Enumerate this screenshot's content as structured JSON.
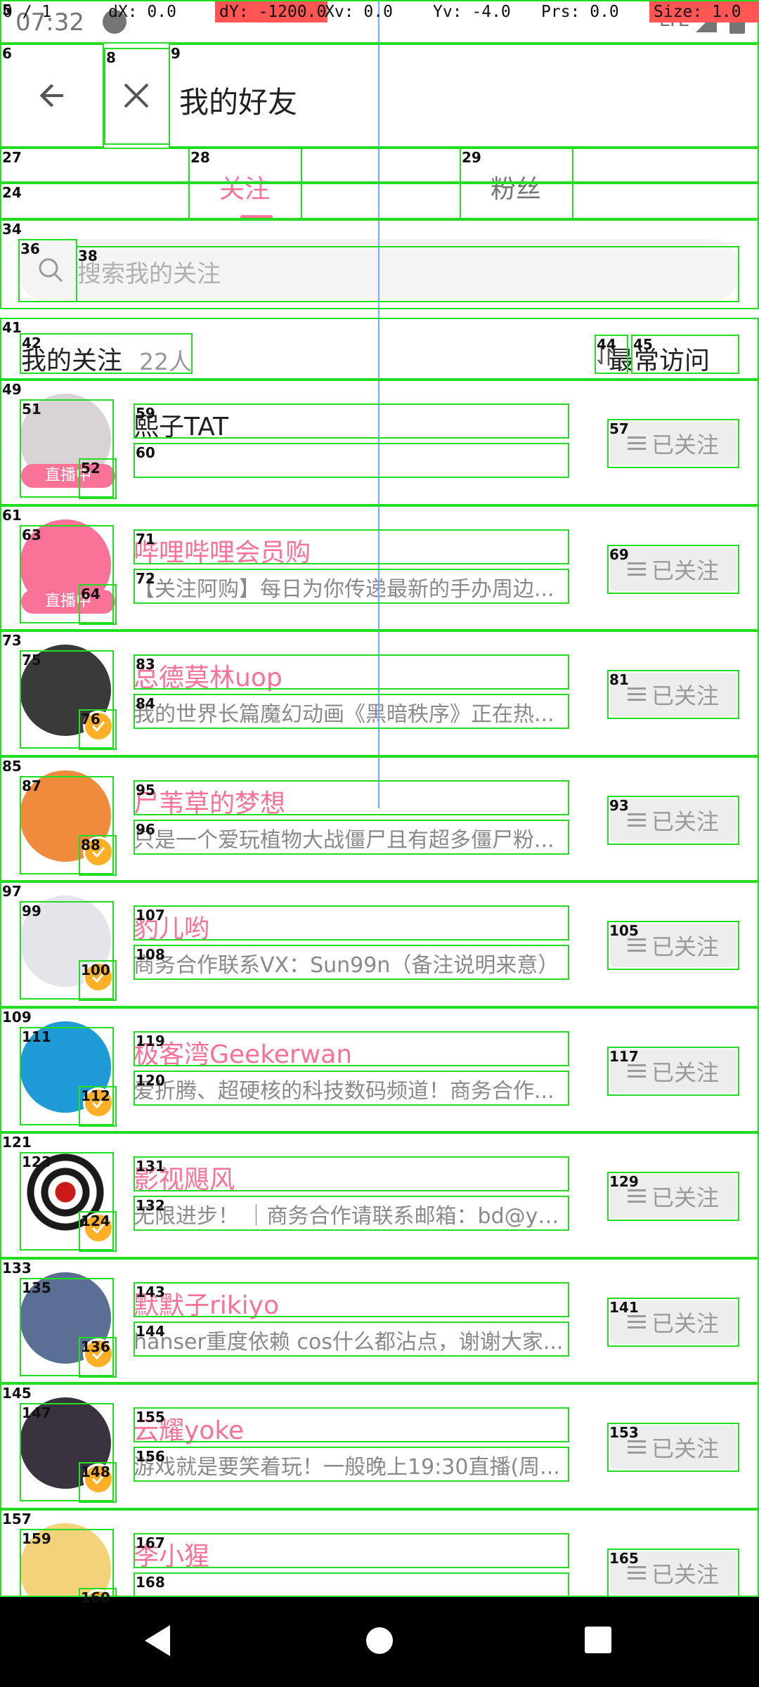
{
  "debug": {
    "pointers": "0 / 1",
    "dx": "dX: 0.0",
    "dy": "dY: -1200.0",
    "xv": "Xv: 0.0",
    "yv": "Yv: -4.0",
    "prs": "Prs: 0.0",
    "size": "Size: 1.0"
  },
  "status_bar": {
    "time": "07:32",
    "network": "LTE"
  },
  "toolbar": {
    "title": "我的好友"
  },
  "tabs": [
    {
      "label": "关注",
      "active": true
    },
    {
      "label": "粉丝",
      "active": false
    }
  ],
  "search": {
    "placeholder": "搜索我的关注"
  },
  "section": {
    "title": "我的关注",
    "count": "22人",
    "sort_label": "最常访问"
  },
  "follow_button_label": "已关注",
  "live_badge_label": "直播中",
  "users": [
    {
      "name": "熙子TAT",
      "desc": "",
      "live": true,
      "verified": false,
      "avatar_color": "#d9d3d6",
      "name_color": "#212121"
    },
    {
      "name": "哔哩哔哩会员购",
      "desc": "【关注阿购】每日为你传递最新的手办周边...",
      "live": true,
      "verified": false,
      "avatar_color": "#fb7299",
      "name_color": "#fb7299"
    },
    {
      "name": "总德莫林uop",
      "desc": "我的世界长篇魔幻动画《黑暗秩序》正在热...",
      "live": false,
      "verified": true,
      "avatar_color": "#3a3a3a",
      "name_color": "#fb7299"
    },
    {
      "name": "尸苇草的梦想",
      "desc": "只是一个爱玩植物大战僵尸且有超多僵尸粉...",
      "live": false,
      "verified": true,
      "avatar_color": "#f08a3c",
      "name_color": "#fb7299"
    },
    {
      "name": "豹儿哟",
      "desc": "商务合作联系VX：Sun99n（备注说明来意）",
      "live": false,
      "verified": true,
      "avatar_color": "#e4e4ea",
      "name_color": "#fb7299"
    },
    {
      "name": "极客湾Geekerwan",
      "desc": "爱折腾、超硬核的科技数码频道！商务合作...",
      "live": false,
      "verified": true,
      "avatar_color": "#1e9ad6",
      "name_color": "#fb7299"
    },
    {
      "name": "影视飓风",
      "desc": "无限进步！ ｜商务合作请联系邮箱：bd@ys...",
      "live": false,
      "verified": true,
      "avatar_color": "#ffffff",
      "name_color": "#fb7299"
    },
    {
      "name": "默默子rikiyo",
      "desc": "hanser重度依赖 cos什么都沾点，谢谢大家...",
      "live": false,
      "verified": true,
      "avatar_color": "#5b6f95",
      "name_color": "#fb7299"
    },
    {
      "name": "云耀yoke",
      "desc": "游戏就是要笑着玩！一般晚上19:30直播(周...",
      "live": false,
      "verified": true,
      "avatar_color": "#3b3240",
      "name_color": "#fb7299"
    },
    {
      "name": "李小猩",
      "desc": "",
      "live": false,
      "verified": true,
      "avatar_color": "#f3d27a",
      "name_color": "#fb7299"
    }
  ]
}
